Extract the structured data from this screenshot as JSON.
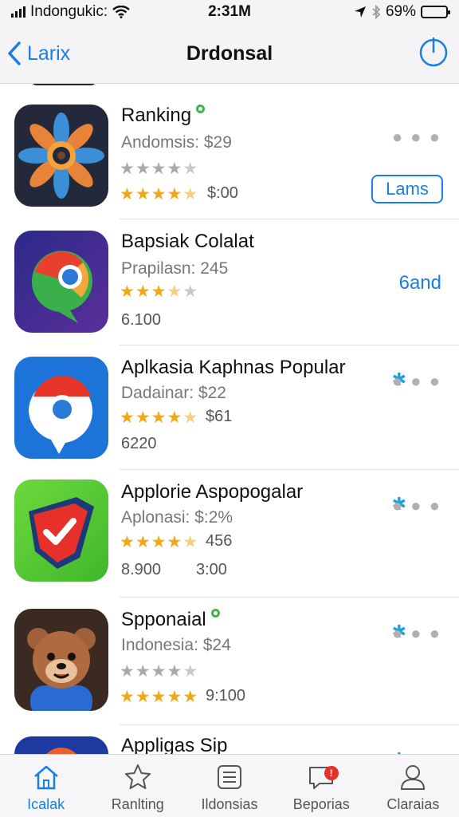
{
  "status": {
    "carrier": "Indongukic:",
    "time": "2:31M",
    "battery": "69%",
    "battery_level": 0.69,
    "icons": [
      "signal-icon",
      "wifi-icon",
      "location-icon",
      "bluetooth-icon",
      "battery-icon"
    ]
  },
  "nav": {
    "back_label": "Larix",
    "title": "Drdonsal",
    "back_icon": "chevron-left-icon",
    "action_icon": "power-icon"
  },
  "apps": [
    {
      "name": "Ranking",
      "subtitle": "Andomsis: $29",
      "stars_grey": 4,
      "rating": 4.5,
      "extra": "$:00",
      "action_label": "Lams"
    },
    {
      "name": "Bapsiak Colalat",
      "subtitle": "Prapilasn: 245",
      "rating": 3.5,
      "extra": "6.100",
      "action_label": "6and"
    },
    {
      "name": "Aplkasia Kaphnas Popular",
      "subtitle": "Dadainar: $22",
      "rating": 4.5,
      "rating_label": "$61",
      "extra": "6220"
    },
    {
      "name": "Applorie Aspopogalar",
      "subtitle": "Aplonasi: $:2%",
      "rating": 4.5,
      "rating_label": "456",
      "extra": "8.900",
      "extra2": "3:00"
    },
    {
      "name": "Spponaial",
      "subtitle": "Indonesia: $24",
      "stars_grey": 4,
      "rating": 5,
      "rating_label": "9:100"
    },
    {
      "name": "Appligas Sip"
    }
  ],
  "tabs": [
    {
      "label": "Icalak",
      "icon": "home-icon"
    },
    {
      "label": "Ranlting",
      "icon": "star-icon"
    },
    {
      "label": "Ildonsias",
      "icon": "list-icon"
    },
    {
      "label": "Beporias",
      "icon": "chat-icon",
      "badge": "!"
    },
    {
      "label": "Claraias",
      "icon": "person-icon"
    }
  ],
  "colors": {
    "accent": "#1a7ee8",
    "star": "#f0a817",
    "badge": "#e5302a"
  }
}
